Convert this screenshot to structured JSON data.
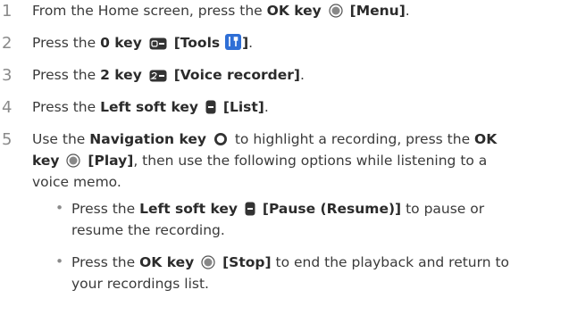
{
  "steps": [
    {
      "number": "1",
      "pre": "From the Home screen, press the",
      "key": "OK key",
      "icon": "ok-key-icon",
      "label": "[Menu]",
      "post": "."
    },
    {
      "number": "2",
      "pre": "Press the",
      "key": "0 key",
      "icon": "zero-key-icon",
      "label_pre": "[Tools",
      "label_icon": "tools-icon",
      "label_post": "]",
      "post": "."
    },
    {
      "number": "3",
      "pre": "Press the",
      "key": "2 key",
      "icon": "two-key-icon",
      "label": "[Voice recorder]",
      "post": "."
    },
    {
      "number": "4",
      "pre": "Press the",
      "key": "Left soft key",
      "icon": "left-soft-key-icon",
      "label": "[List]",
      "post": "."
    },
    {
      "number": "5",
      "line1_pre": "Use the",
      "line1_key": "Navigation key",
      "line1_icon": "navigation-key-icon",
      "line1_mid": "to highlight a recording, press the",
      "line1_end": "OK",
      "line2_key": "key",
      "line2_icon": "ok-key-icon",
      "line2_label": "[Play]",
      "line2_post": ", then use the following options while listening to a",
      "line3": "voice memo."
    }
  ],
  "bullets": [
    {
      "line1_pre": "Press the",
      "line1_key": "Left soft key",
      "line1_icon": "left-soft-key-icon",
      "line1_label": "[Pause (Resume)]",
      "line1_post": "to pause or",
      "line2": "resume the recording."
    },
    {
      "line1_pre": "Press the",
      "line1_key": "OK key",
      "line1_icon": "ok-key-icon",
      "line1_label": "[Stop]",
      "line1_post": "to end the playback and return to",
      "line2": "your recordings list."
    }
  ],
  "bullet_glyph": "•",
  "colors": {
    "text": "#3a3a3a",
    "bold": "#2b2b2b",
    "number": "#8a8a8a",
    "tools_icon_bg": "#2f6fd6"
  }
}
